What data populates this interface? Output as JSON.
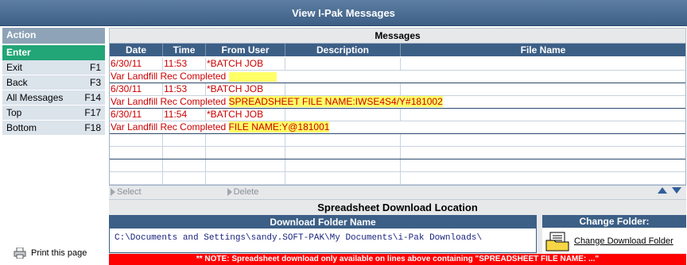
{
  "window": {
    "title": "View I-Pak Messages"
  },
  "sidebar": {
    "header": "Action",
    "enter_label": "Enter",
    "items": [
      {
        "label": "Exit",
        "key": "F1"
      },
      {
        "label": "Back",
        "key": "F3"
      },
      {
        "label": "All Messages",
        "key": "F14"
      },
      {
        "label": "Top",
        "key": "F17"
      },
      {
        "label": "Bottom",
        "key": "F18"
      }
    ],
    "print_label": "Print this page"
  },
  "messages": {
    "title": "Messages",
    "columns": [
      "Date",
      "Time",
      "From User",
      "Description",
      "File Name"
    ],
    "rows": [
      {
        "date": "6/30/11",
        "time": "11:53",
        "from_user": "*BATCH JOB",
        "description": "",
        "file_name": "",
        "text": "Var Landfill Rec Completed",
        "highlight": ""
      },
      {
        "date": "6/30/11",
        "time": "11:53",
        "from_user": "*BATCH JOB",
        "description": "",
        "file_name": "",
        "text": "Var Landfill Rec Completed",
        "highlight": "SPREADSHEET FILE NAME:IWSE4S4/Y#181002"
      },
      {
        "date": "6/30/11",
        "time": "11:54",
        "from_user": "*BATCH JOB",
        "description": "",
        "file_name": "",
        "text": "Var Landfill Rec Completed",
        "highlight": "FILE NAME:Y@181001"
      }
    ]
  },
  "actions": {
    "select_label": "Select",
    "delete_label": "Delete"
  },
  "spreadsheet": {
    "title": "Spreadsheet Download Location",
    "folder_header": "Download Folder Name",
    "folder_path": "C:\\Documents and Settings\\sandy.SOFT-PAK\\My Documents\\i-Pak Downloads\\",
    "change_header": "Change Folder:",
    "change_label": "Change Download Folder"
  },
  "note": "** NOTE:  Spreadsheet download only available on lines above containing \"SPREADSHEET FILE NAME: ...\"",
  "colors": {
    "title_bar": "#3d5f86",
    "enter": "#22a577",
    "highlight": "#ffff66",
    "text_red": "#cc0000",
    "note_bg": "#ff0000"
  }
}
